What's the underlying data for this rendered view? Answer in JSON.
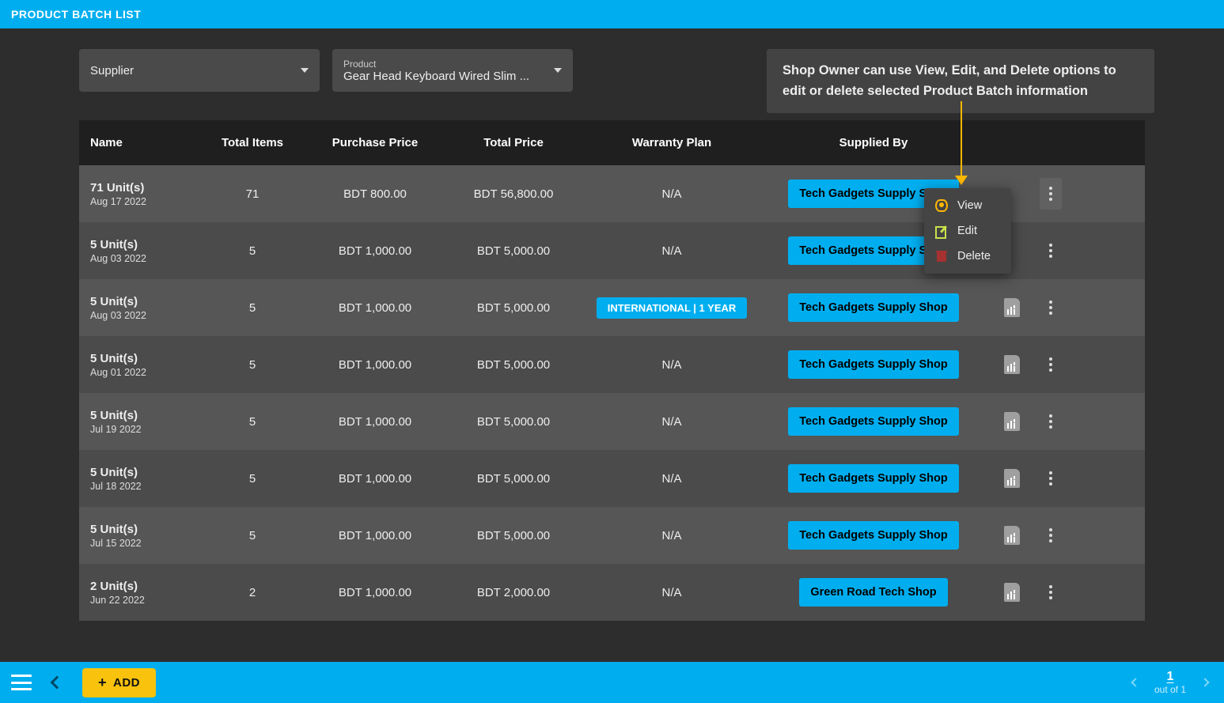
{
  "header": {
    "title": "PRODUCT BATCH LIST"
  },
  "filters": {
    "supplier": {
      "label": "Supplier",
      "value": ""
    },
    "product": {
      "label": "Product",
      "value": "Gear Head Keyboard Wired Slim ..."
    }
  },
  "tooltip": "Shop Owner can use View, Edit, and Delete options to edit or delete selected Product Batch information",
  "columns": {
    "name": "Name",
    "total_items": "Total Items",
    "purchase_price": "Purchase Price",
    "total_price": "Total Price",
    "warranty_plan": "Warranty Plan",
    "supplied_by": "Supplied By"
  },
  "rows": [
    {
      "name": "71 Unit(s)",
      "date": "Aug 17 2022",
      "total_items": "71",
      "purchase_price": "BDT 800.00",
      "total_price": "BDT 56,800.00",
      "warranty": "N/A",
      "supplier": "Tech Gadgets Supply Shop",
      "show_report": false,
      "menu_open": true
    },
    {
      "name": "5 Unit(s)",
      "date": "Aug 03 2022",
      "total_items": "5",
      "purchase_price": "BDT 1,000.00",
      "total_price": "BDT 5,000.00",
      "warranty": "N/A",
      "supplier": "Tech Gadgets Supply Shop",
      "show_report": false,
      "menu_open": false
    },
    {
      "name": "5 Unit(s)",
      "date": "Aug 03 2022",
      "total_items": "5",
      "purchase_price": "BDT 1,000.00",
      "total_price": "BDT 5,000.00",
      "warranty": "INTERNATIONAL | 1 YEAR",
      "warranty_badge": true,
      "supplier": "Tech Gadgets Supply Shop",
      "show_report": true,
      "menu_open": false
    },
    {
      "name": "5 Unit(s)",
      "date": "Aug 01 2022",
      "total_items": "5",
      "purchase_price": "BDT 1,000.00",
      "total_price": "BDT 5,000.00",
      "warranty": "N/A",
      "supplier": "Tech Gadgets Supply Shop",
      "show_report": true,
      "menu_open": false
    },
    {
      "name": "5 Unit(s)",
      "date": "Jul 19 2022",
      "total_items": "5",
      "purchase_price": "BDT 1,000.00",
      "total_price": "BDT 5,000.00",
      "warranty": "N/A",
      "supplier": "Tech Gadgets Supply Shop",
      "show_report": true,
      "menu_open": false
    },
    {
      "name": "5 Unit(s)",
      "date": "Jul 18 2022",
      "total_items": "5",
      "purchase_price": "BDT 1,000.00",
      "total_price": "BDT 5,000.00",
      "warranty": "N/A",
      "supplier": "Tech Gadgets Supply Shop",
      "show_report": true,
      "menu_open": false
    },
    {
      "name": "5 Unit(s)",
      "date": "Jul 15 2022",
      "total_items": "5",
      "purchase_price": "BDT 1,000.00",
      "total_price": "BDT 5,000.00",
      "warranty": "N/A",
      "supplier": "Tech Gadgets Supply Shop",
      "show_report": true,
      "menu_open": false
    },
    {
      "name": "2 Unit(s)",
      "date": "Jun 22 2022",
      "total_items": "2",
      "purchase_price": "BDT 1,000.00",
      "total_price": "BDT 2,000.00",
      "warranty": "N/A",
      "supplier": "Green Road Tech Shop",
      "show_report": true,
      "menu_open": false
    }
  ],
  "context_menu": {
    "view": "View",
    "edit": "Edit",
    "delete": "Delete"
  },
  "footer": {
    "add_label": "ADD",
    "page": "1",
    "out_of": "out of 1"
  }
}
